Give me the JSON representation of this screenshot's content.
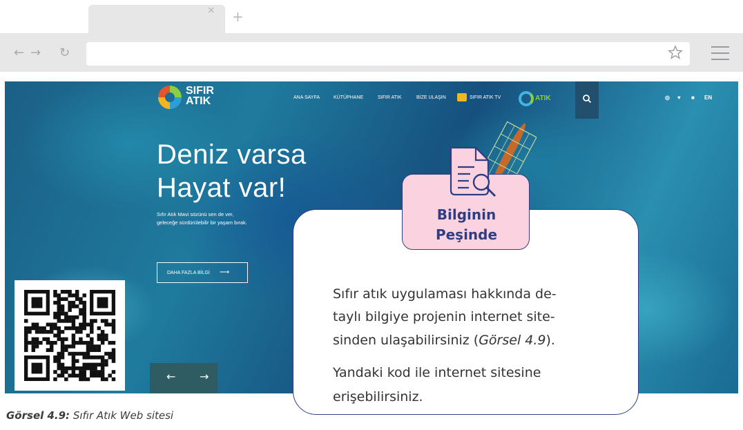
{
  "browser": {
    "tab_close_glyph": "×",
    "new_tab_glyph": "+",
    "back_glyph": "←",
    "forward_glyph": "→",
    "reload_glyph": "↻",
    "address_value": ""
  },
  "website": {
    "logo_text": "SIFIR\nATIK",
    "nav": [
      "ANA SAYFA",
      "KÜTÜPHANE",
      "SIFIR ATIK",
      "BİZE ULAŞIN",
      "SIFIR ATIK TV"
    ],
    "mavi_logo_text": "ATIK",
    "social": [
      "◎",
      "♥",
      "■",
      "EN"
    ],
    "hero_title": "Deniz varsa\nHayat var!",
    "hero_subtitle": "Sıfır Atık Mavi sözünü sen de ver,\ngeleceğe sürdürülebilir bir yaşam bırak.",
    "hero_button": "DAHA FAZLA BİLGİ",
    "hero_button_arrow": "⟶",
    "slider_prev": "←",
    "slider_next": "→"
  },
  "badge": {
    "line1": "Bilginin",
    "line2": "Peşinde"
  },
  "card": {
    "line1": "Sıfır atık uygulaması hakkında de-",
    "line2": "taylı bilgiye projenin internet site-",
    "line3_start": "sinden ulaşabilirsiniz (",
    "line3_italic": "Görsel 4.9",
    "line3_end": ").",
    "line4": "Yandaki kod ile internet sitesine",
    "line5": "erişebilirsiniz."
  },
  "caption": {
    "label": "Görsel 4.9:",
    "text": " Sıfır Atık Web sitesi"
  },
  "colors": {
    "accent": "#2f3d83",
    "badge_bg": "#fbd3e0",
    "chrome": "#e7e7e8"
  }
}
